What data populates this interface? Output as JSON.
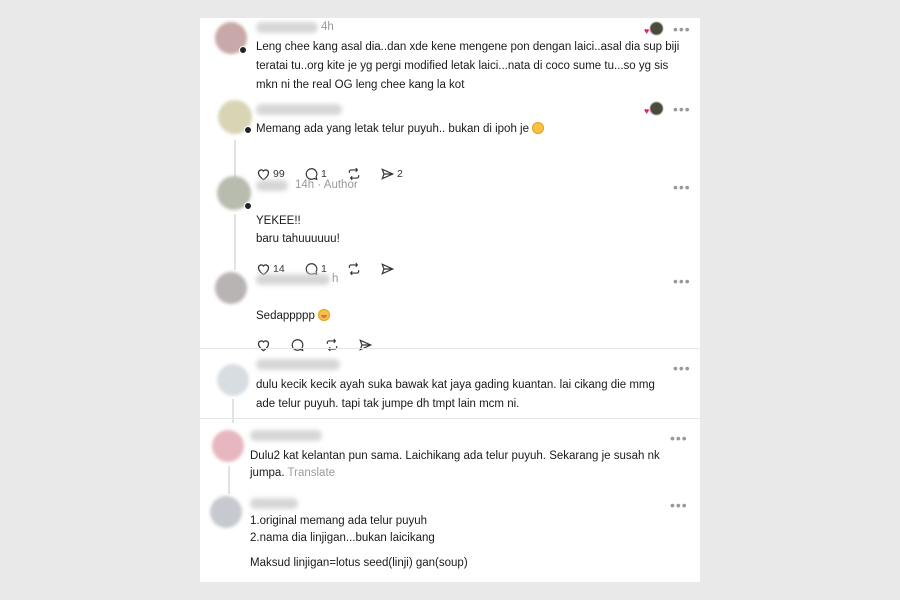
{
  "colors": {
    "background": "#e9e9e9",
    "panel": "#ffffff",
    "meta_gray": "#9a9a9a",
    "heart": "#e0245e"
  },
  "posts": [
    {
      "time": "4h",
      "lines": [
        "Leng chee kang asal dia..dan xde kene mengene pon dengan laici..asal dia sup biji",
        "teratai tu..org kite je yg pergi modified letak laici...nata di coco sume tu...so yg sis",
        "mkn ni the real OG leng chee kang la kot"
      ],
      "liked_by_author": true
    },
    {
      "lines": [
        "Memang ada yang letak telur puyuh.. bukan di ipoh je"
      ],
      "emoji": "smile",
      "liked_by_author": true,
      "actions": {
        "likes": "99",
        "replies": "1",
        "reposts": "",
        "shares": "2"
      }
    },
    {
      "time": "14h",
      "badge": "Author",
      "lines": [
        "YEKEE!!",
        "baru tahuuuuuu!"
      ],
      "actions": {
        "likes": "14",
        "replies": "1",
        "reposts": "",
        "shares": ""
      }
    },
    {
      "time": "h",
      "lines": [
        "Sedappppp"
      ],
      "emoji": "drool",
      "actions": {
        "likes": "",
        "replies": "",
        "reposts": "",
        "shares": ""
      }
    },
    {
      "lines": [
        "dulu kecik kecik ayah suka bawak kat jaya gading kuantan. lai cikang die mmg",
        "ade telur puyuh. tapi tak jumpe dh tmpt lain mcm ni."
      ]
    },
    {
      "lines": [
        "Dulu2 kat kelantan pun sama. Laichikang ada telur puyuh. Sekarang je susah nk",
        "jumpa."
      ],
      "translate": "Translate"
    },
    {
      "lines": [
        "1.original memang ada telur puyuh",
        "2.nama dia linjigan...bukan laicikang",
        "",
        "Maksud linjigan=lotus seed(linji) gan(soup)"
      ]
    }
  ]
}
